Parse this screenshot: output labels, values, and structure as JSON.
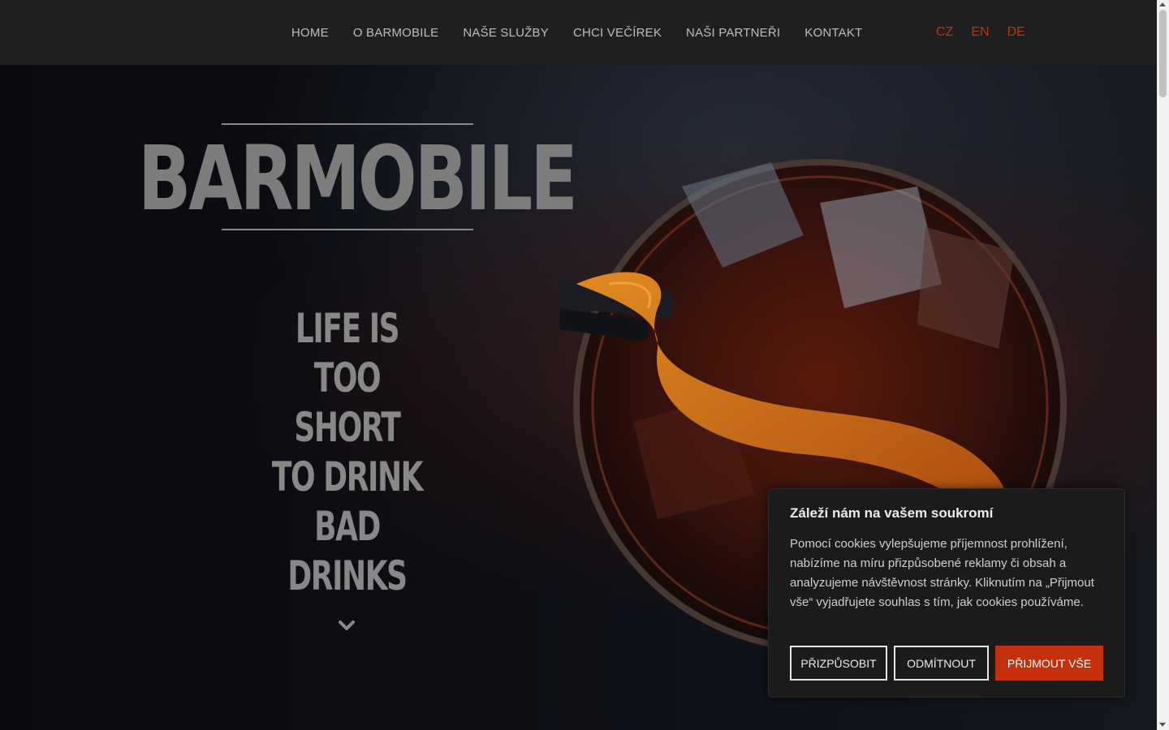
{
  "nav": {
    "items": [
      {
        "label": "HOME"
      },
      {
        "label": "O BARMOBILE"
      },
      {
        "label": "NAŠE SLUŽBY"
      },
      {
        "label": "CHCI VEČÍREK"
      },
      {
        "label": "NAŠI PARTNEŘI"
      },
      {
        "label": "KONTAKT"
      }
    ],
    "languages": [
      {
        "label": "CZ"
      },
      {
        "label": "EN"
      },
      {
        "label": "DE"
      }
    ]
  },
  "hero": {
    "logo": "BARMOBILE",
    "tagline_lines": [
      "LIFE IS",
      "TOO",
      "SHORT",
      "TO DRINK",
      "BAD",
      "DRINKS"
    ],
    "scroll_icon": "chevron-down-icon"
  },
  "cookie": {
    "title": "Záleží nám na vašem soukromí",
    "text": "Pomocí cookies vylepšujeme příjemnost prohlížení, nabízíme na míru přizpůsobené reklamy či obsah a analyzujeme návštěvnost stránky. Kliknutím na „Přijmout vše“ vyjadřujete souhlas s tím, jak cookies používáme.",
    "customize": "PŘIZPŮSOBIT",
    "reject": "ODMÍTNOUT",
    "accept": "PŘIJMOUT VŠE"
  },
  "colors": {
    "accent": "#c42f0c",
    "lang": "#b7351a",
    "nav_bg": "#1f1f1f"
  }
}
